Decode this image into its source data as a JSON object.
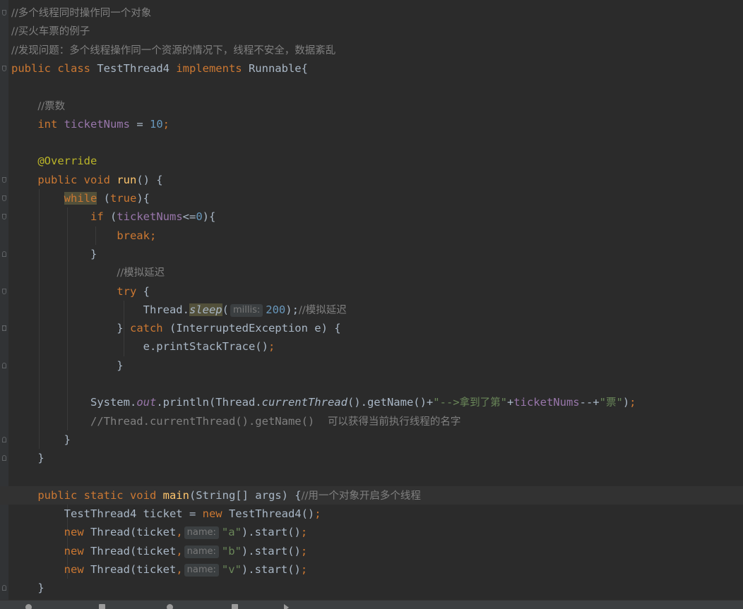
{
  "editor": {
    "lines": [
      [
        {
          "t": "//多个线程同时操作同一个对象",
          "c": "cmcn"
        }
      ],
      [
        {
          "t": "//买火车票的例子",
          "c": "cmcn"
        }
      ],
      [
        {
          "t": "//发现问题：多个线程操作同一个资源的情况下，线程不安全，数据紊乱",
          "c": "cmcn"
        }
      ],
      [
        {
          "t": "public class ",
          "c": "kw"
        },
        {
          "t": "TestThread4 "
        },
        {
          "t": "implements ",
          "c": "kw"
        },
        {
          "t": "Runnable{"
        }
      ],
      [],
      [
        {
          "t": "    "
        },
        {
          "t": "//票数",
          "c": "cmcn"
        }
      ],
      [
        {
          "t": "    "
        },
        {
          "t": "int ",
          "c": "kw"
        },
        {
          "t": "ticketNums",
          "c": "field"
        },
        {
          "t": " = "
        },
        {
          "t": "10",
          "c": "num"
        },
        {
          "t": ";",
          "c": "kw"
        }
      ],
      [],
      [
        {
          "t": "    "
        },
        {
          "t": "@Override",
          "c": "ann"
        }
      ],
      [
        {
          "t": "    "
        },
        {
          "t": "public void ",
          "c": "kw"
        },
        {
          "t": "run",
          "c": "fn"
        },
        {
          "t": "() {"
        }
      ],
      [
        {
          "t": "        "
        },
        {
          "t": "while",
          "c": "kw mark"
        },
        {
          "t": " ("
        },
        {
          "t": "true",
          "c": "kw"
        },
        {
          "t": "){"
        }
      ],
      [
        {
          "t": "            "
        },
        {
          "t": "if ",
          "c": "kw"
        },
        {
          "t": "("
        },
        {
          "t": "ticketNums",
          "c": "field"
        },
        {
          "t": "<="
        },
        {
          "t": "0",
          "c": "num"
        },
        {
          "t": "){"
        }
      ],
      [
        {
          "t": "                "
        },
        {
          "t": "break;",
          "c": "kw"
        }
      ],
      [
        {
          "t": "            }"
        }
      ],
      [
        {
          "t": "                "
        },
        {
          "t": "//模拟延迟",
          "c": "cmcn"
        }
      ],
      [
        {
          "t": "                "
        },
        {
          "t": "try ",
          "c": "kw"
        },
        {
          "t": "{"
        }
      ],
      [
        {
          "t": "                    Thread."
        },
        {
          "t": "sleep",
          "c": "smeth mark"
        },
        {
          "t": "("
        },
        {
          "h": "millis:"
        },
        {
          "t": "200",
          "c": "num"
        },
        {
          "t": ");"
        },
        {
          "t": "//模拟延迟",
          "c": "cmcn"
        }
      ],
      [
        {
          "t": "                } "
        },
        {
          "t": "catch ",
          "c": "kw"
        },
        {
          "t": "(InterruptedException e) {"
        }
      ],
      [
        {
          "t": "                    e.printStackTrace()"
        },
        {
          "t": ";",
          "c": "kw"
        }
      ],
      [
        {
          "t": "                }"
        }
      ],
      [],
      [
        {
          "t": "            System."
        },
        {
          "t": "out",
          "c": "sfield"
        },
        {
          "t": ".println(Thread."
        },
        {
          "t": "currentThread",
          "c": "smeth"
        },
        {
          "t": "().getName()+"
        },
        {
          "t": "\"-->",
          "c": "str"
        },
        {
          "t": "拿到了第",
          "c": "strcn"
        },
        {
          "t": "\"",
          "c": "str"
        },
        {
          "t": "+"
        },
        {
          "t": "ticketNums",
          "c": "field"
        },
        {
          "t": "--+"
        },
        {
          "t": "\"",
          "c": "str"
        },
        {
          "t": "票",
          "c": "strcn"
        },
        {
          "t": "\"",
          "c": "str"
        },
        {
          "t": ")"
        },
        {
          "t": ";",
          "c": "kw"
        }
      ],
      [
        {
          "t": "            "
        },
        {
          "t": "//Thread.currentThread().getName()  ",
          "c": "cm"
        },
        {
          "t": "可以获得当前执行线程的名字",
          "c": "cmcn"
        }
      ],
      [
        {
          "t": "        }"
        }
      ],
      [
        {
          "t": "    }"
        }
      ],
      [],
      [
        {
          "t": "    "
        },
        {
          "t": "public static void ",
          "c": "kw"
        },
        {
          "t": "main",
          "c": "fn"
        },
        {
          "t": "(String[] args) {"
        },
        {
          "t": "//用一个对象开启多个线程",
          "c": "cmcn"
        }
      ],
      [
        {
          "t": "        TestThread4 ticket = "
        },
        {
          "t": "new ",
          "c": "kw"
        },
        {
          "t": "TestThread4()"
        },
        {
          "t": ";",
          "c": "kw"
        }
      ],
      [
        {
          "t": "        "
        },
        {
          "t": "new ",
          "c": "kw"
        },
        {
          "t": "Thread(ticket"
        },
        {
          "t": ",",
          "c": "kw"
        },
        {
          "h": "name:"
        },
        {
          "t": "\"a\"",
          "c": "str"
        },
        {
          "t": ").start()"
        },
        {
          "t": ";",
          "c": "kw"
        }
      ],
      [
        {
          "t": "        "
        },
        {
          "t": "new ",
          "c": "kw"
        },
        {
          "t": "Thread(ticket"
        },
        {
          "t": ",",
          "c": "kw"
        },
        {
          "h": "name:"
        },
        {
          "t": "\"b\"",
          "c": "str"
        },
        {
          "t": ").start()"
        },
        {
          "t": ";",
          "c": "kw"
        }
      ],
      [
        {
          "t": "        "
        },
        {
          "t": "new ",
          "c": "kw"
        },
        {
          "t": "Thread(ticket"
        },
        {
          "t": ",",
          "c": "kw"
        },
        {
          "h": "name:"
        },
        {
          "t": "\"v\"",
          "c": "str"
        },
        {
          "t": ").start()"
        },
        {
          "t": ";",
          "c": "kw"
        }
      ],
      [
        {
          "t": "    }"
        }
      ]
    ]
  },
  "colors": {
    "background": "#2b2b2b",
    "keyword": "#cc7832",
    "comment": "#808080",
    "string": "#6a8759",
    "number": "#6897bb",
    "field": "#9876aa",
    "function": "#ffc66d",
    "annotation": "#bbb529"
  }
}
